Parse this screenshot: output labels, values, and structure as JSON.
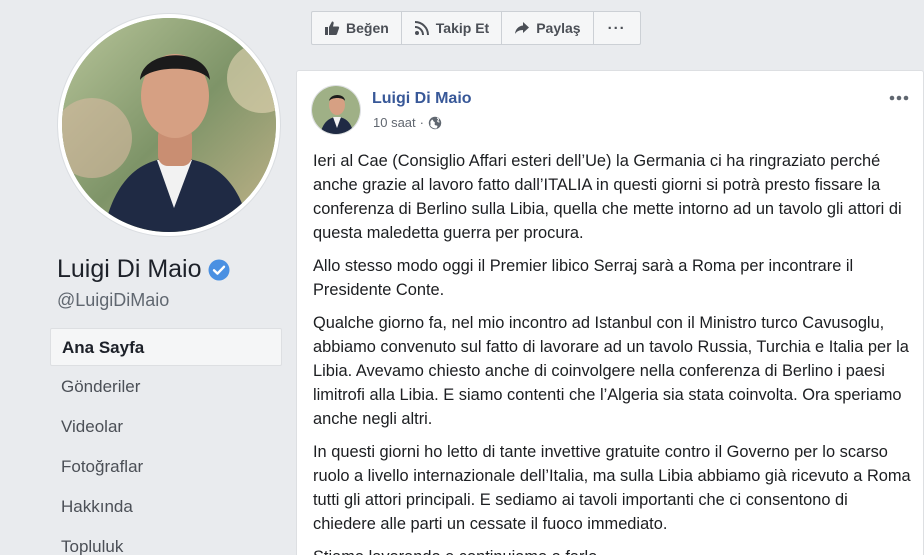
{
  "profile": {
    "name": "Luigi Di Maio",
    "handle": "@LuigiDiMaio",
    "verified_icon": "verified-badge-icon",
    "accent_color": "#4267b2"
  },
  "nav": {
    "items": [
      {
        "label": "Ana Sayfa",
        "active": true
      },
      {
        "label": "Gönderiler",
        "active": false
      },
      {
        "label": "Videolar",
        "active": false
      },
      {
        "label": "Fotoğraflar",
        "active": false
      },
      {
        "label": "Hakkında",
        "active": false
      },
      {
        "label": "Topluluk",
        "active": false
      }
    ]
  },
  "actions": {
    "like_label": "Beğen",
    "follow_label": "Takip Et",
    "share_label": "Paylaş",
    "more_label": "···"
  },
  "post": {
    "author": "Luigi Di Maio",
    "time": "10 saat",
    "dot": "·",
    "privacy_icon": "globe-icon",
    "paragraphs": [
      "Ieri al Cae (Consiglio Affari esteri dell’Ue) la Germania ci ha ringraziato perché anche grazie al lavoro fatto dall’ITALIA in questi giorni si potrà presto fissare la conferenza di Berlino sulla Libia, quella che mette intorno ad un tavolo gli attori di questa maledetta guerra per procura.",
      "Allo stesso modo oggi il Premier libico Serraj sarà a Roma per incontrare il Presidente Conte.",
      "Qualche giorno fa, nel mio incontro ad Istanbul con il Ministro turco Cavusoglu, abbiamo convenuto sul fatto di lavorare ad un tavolo Russia, Turchia e Italia per la Libia. Avevamo chiesto anche di coinvolgere nella conferenza di Berlino i paesi limitrofi alla Libia. E siamo contenti che l’Algeria sia stata coinvolta. Ora speriamo anche negli altri.",
      "In questi giorni ho letto di tante invettive gratuite contro il Governo per lo scarso ruolo a livello internazionale dell’Italia, ma sulla Libia abbiamo già ricevuto a Roma tutti gli attori principali. E sediamo ai tavoli importanti che ci consentono di chiedere alle parti un cessate il fuoco immediato.",
      "Stiamo lavorando e continuiamo a farlo."
    ]
  }
}
